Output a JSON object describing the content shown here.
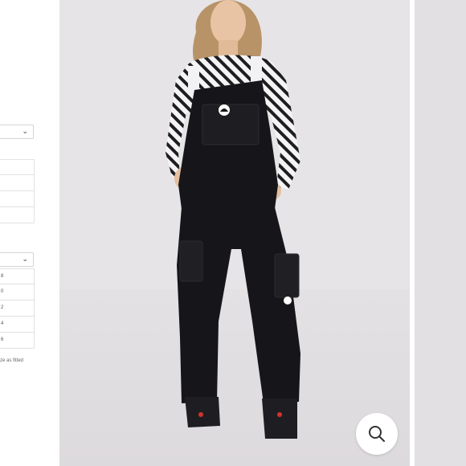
{
  "left_panel": {
    "size_rows": [
      "",
      "",
      "",
      ""
    ],
    "quantity_rows": [
      "8",
      "0",
      "2",
      "4",
      "6"
    ],
    "fit_note": "ze as fitted"
  },
  "zoom": {
    "icon": "search-icon"
  },
  "colors": {
    "backdrop": "#e6e4e6",
    "garment": "#16161a",
    "white": "#ffffff"
  }
}
